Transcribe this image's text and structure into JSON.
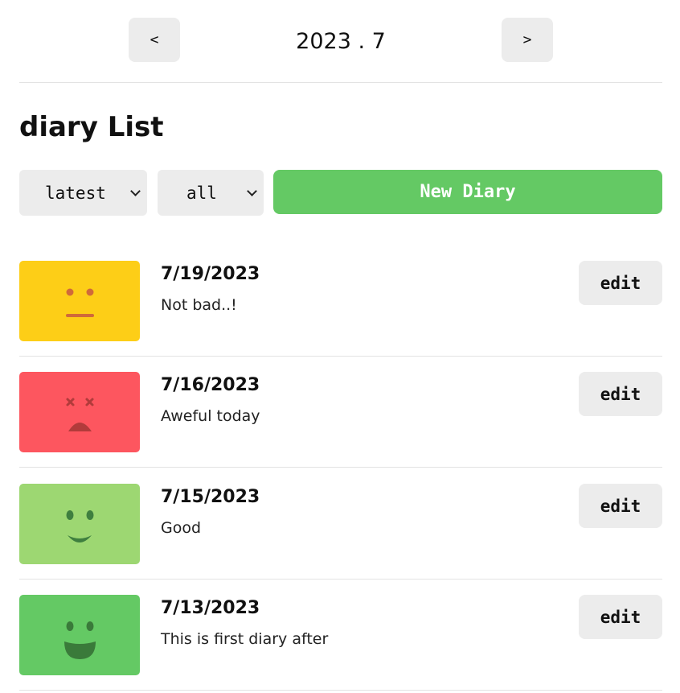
{
  "header": {
    "prev_label": "<",
    "next_label": ">",
    "month_label": "2023 . 7"
  },
  "list": {
    "title": "diary List",
    "order_select": {
      "selected": "latest"
    },
    "filter_select": {
      "selected": "all"
    },
    "new_button_label": "New Diary"
  },
  "items": [
    {
      "date": "7/19/2023",
      "content": "Not bad..!",
      "emotion": "neutral-face-icon",
      "color": "#fdce17",
      "edit_label": "edit"
    },
    {
      "date": "7/16/2023",
      "content": "Aweful today",
      "emotion": "awful-face-icon",
      "color": "#fd565f",
      "edit_label": "edit"
    },
    {
      "date": "7/15/2023",
      "content": "Good",
      "emotion": "smile-face-icon",
      "color": "#9dd772",
      "edit_label": "edit"
    },
    {
      "date": "7/13/2023",
      "content": "This is first diary after",
      "emotion": "laughing-face-icon",
      "color": "#64c964",
      "edit_label": "edit"
    }
  ]
}
